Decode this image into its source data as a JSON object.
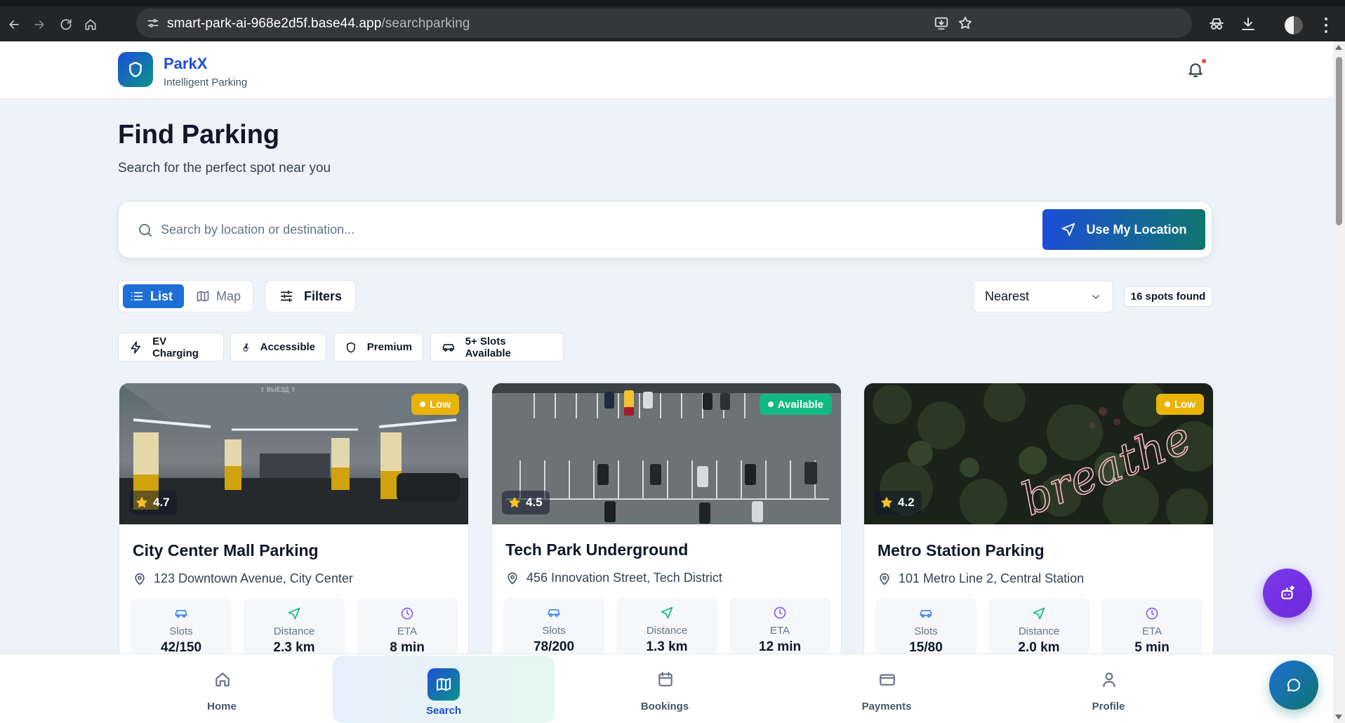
{
  "browser": {
    "url_host": "smart-park-ai-968e2d5f.base44.app",
    "url_path": "/searchparking"
  },
  "header": {
    "brand": "ParkX",
    "tagline": "Intelligent Parking",
    "notification_unread": true
  },
  "page": {
    "title": "Find Parking",
    "subtitle": "Search for the perfect spot near you"
  },
  "search": {
    "placeholder": "Search by location or destination...",
    "value": "",
    "use_location_label": "Use My Location"
  },
  "toolbar": {
    "view_list_label": "List",
    "view_map_label": "Map",
    "active_view": "List",
    "filters_label": "Filters",
    "sort_selected": "Nearest",
    "count_text": "16 spots found"
  },
  "chips": [
    {
      "label": "EV Charging",
      "icon": "zap-icon"
    },
    {
      "label": "Accessible",
      "icon": "accessibility-icon"
    },
    {
      "label": "Premium",
      "icon": "shield-icon"
    },
    {
      "label": "5+ Slots Available",
      "icon": "car-icon"
    }
  ],
  "spots": [
    {
      "name": "City Center Mall Parking",
      "address": "123 Downtown Avenue, City Center",
      "rating": "4.7",
      "status": "Low",
      "slots_label": "Slots",
      "slots": "42/150",
      "distance_label": "Distance",
      "distance": "2.3 km",
      "eta_label": "ETA",
      "eta": "8 min",
      "image": "underground garage interior"
    },
    {
      "name": "Tech Park Underground",
      "address": "456 Innovation Street, Tech District",
      "rating": "4.5",
      "status": "Available",
      "slots_label": "Slots",
      "slots": "78/200",
      "distance_label": "Distance",
      "distance": "1.3 km",
      "eta_label": "ETA",
      "eta": "12 min",
      "image": "aerial parking lot"
    },
    {
      "name": "Metro Station Parking",
      "address": "101 Metro Line 2, Central Station",
      "rating": "4.2",
      "status": "Low",
      "slots_label": "Slots",
      "slots": "15/80",
      "distance_label": "Distance",
      "distance": "2.0 km",
      "eta_label": "ETA",
      "eta": "5 min",
      "image": "neon sign on foliage",
      "image_text": "breathe"
    }
  ],
  "bottom_nav": [
    {
      "label": "Home",
      "icon": "home-icon"
    },
    {
      "label": "Search",
      "icon": "map-icon",
      "active": true
    },
    {
      "label": "Bookings",
      "icon": "calendar-icon"
    },
    {
      "label": "Payments",
      "icon": "credit-card-icon"
    },
    {
      "label": "Profile",
      "icon": "user-icon"
    }
  ],
  "colors": {
    "primary": "#1d4ed8",
    "teal": "#0f766e",
    "low": "#eab308",
    "available": "#10b981",
    "ai_fab": "#7c3aed"
  }
}
